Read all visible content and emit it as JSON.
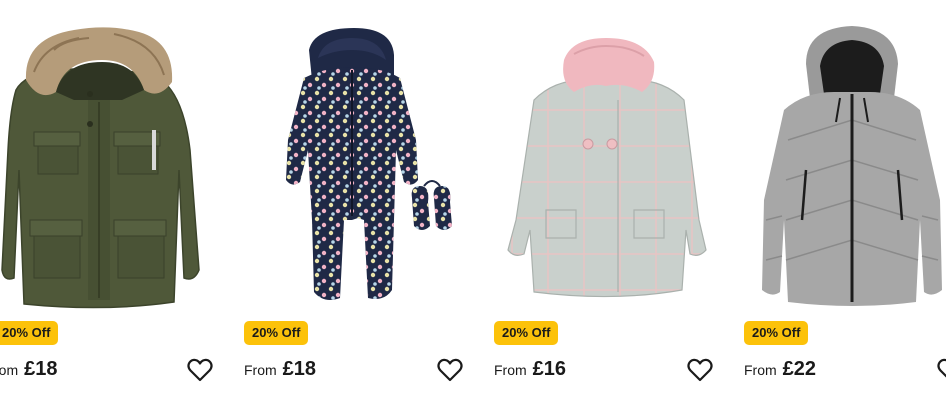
{
  "products": [
    {
      "id": "card-0",
      "image_alt": "khaki parka with faux fur hood",
      "badge": "20% Off",
      "price_prefix": "rom",
      "price": "£18",
      "wishlist_icon": "heart-outline-icon"
    },
    {
      "id": "card-1",
      "image_alt": "navy spotted snowsuit with mittens",
      "badge": "20% Off",
      "price_prefix": "From",
      "price": "£18",
      "wishlist_icon": "heart-outline-icon"
    },
    {
      "id": "card-2",
      "image_alt": "grey check coat with pink faux fur collar",
      "badge": "20% Off",
      "price_prefix": "From",
      "price": "£16",
      "wishlist_icon": "heart-outline-icon"
    },
    {
      "id": "card-3",
      "image_alt": "grey hooded puffer jacket",
      "badge": "20% Off",
      "price_prefix": "From",
      "price": "£22",
      "wishlist_icon": "heart-outline-icon"
    }
  ],
  "colors": {
    "badge_background": "#fcc20a",
    "text": "#1a1a1a"
  }
}
